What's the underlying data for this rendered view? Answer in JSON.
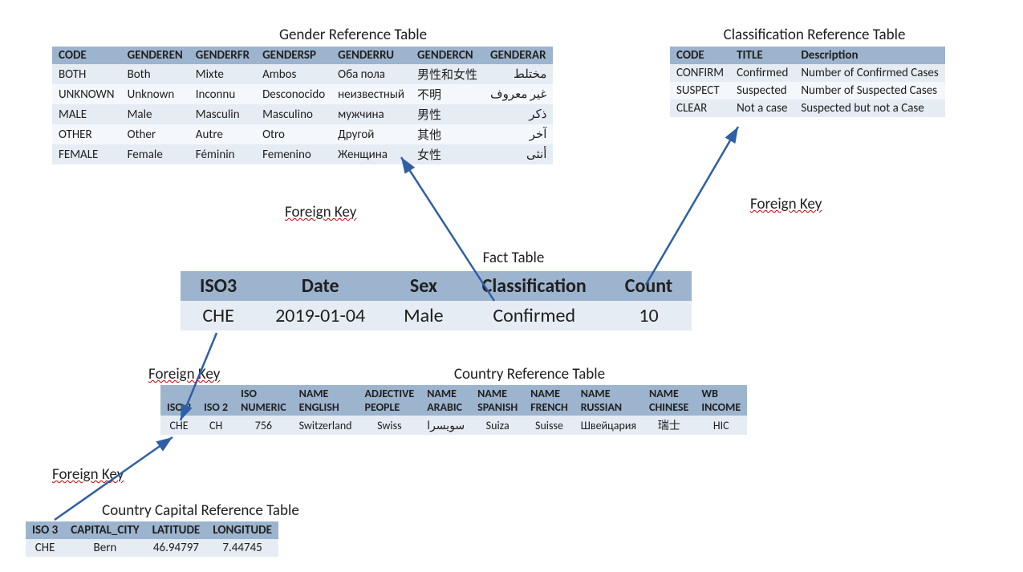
{
  "gender": {
    "title": "Gender Reference Table",
    "headers": [
      "CODE",
      "GENDEREN",
      "GENDERFR",
      "GENDERSP",
      "GENDERRU",
      "GENDERCN",
      "GENDERAR"
    ],
    "rows": [
      [
        "BOTH",
        "Both",
        "Mixte",
        "Ambos",
        "Оба пола",
        "男性和女性",
        "مختلط"
      ],
      [
        "UNKNOWN",
        "Unknown",
        "Inconnu",
        "Desconocido",
        "неизвестный",
        "不明",
        "غير معروف"
      ],
      [
        "MALE",
        "Male",
        "Masculin",
        "Masculino",
        "мужчина",
        "男性",
        "ذكر"
      ],
      [
        "OTHER",
        "Other",
        "Autre",
        "Otro",
        "Другой",
        "其他",
        "آخر"
      ],
      [
        "FEMALE",
        "Female",
        "Féminin",
        "Femenino",
        "Женщина",
        "女性",
        "أنثى"
      ]
    ]
  },
  "classification": {
    "title": "Classification Reference Table",
    "headers": [
      "CODE",
      "TITLE",
      "Description"
    ],
    "rows": [
      [
        "CONFIRM",
        "Confirmed",
        "Number of Confirmed Cases"
      ],
      [
        "SUSPECT",
        "Suspected",
        "Number of Suspected Cases"
      ],
      [
        "CLEAR",
        "Not a case",
        "Suspected but not a Case"
      ]
    ]
  },
  "fact": {
    "title": "Fact Table",
    "headers": [
      "ISO3",
      "Date",
      "Sex",
      "Classification",
      "Count"
    ],
    "row": [
      "CHE",
      "2019-01-04",
      "Male",
      "Confirmed",
      "10"
    ]
  },
  "country": {
    "title": "Country Reference Table",
    "headers": [
      "ISO 3",
      "ISO 2",
      "ISO NUMERIC",
      "NAME ENGLISH",
      "ADJECTIVE PEOPLE",
      "NAME ARABIC",
      "NAME SPANISH",
      "NAME FRENCH",
      "NAME RUSSIAN",
      "NAME CHINESE",
      "WB INCOME"
    ],
    "rows": [
      [
        "CHE",
        "CH",
        "756",
        "Switzerland",
        "Swiss",
        "سويسرا",
        "Suiza",
        "Suisse",
        "Швейцария",
        "瑞士",
        "HIC"
      ]
    ]
  },
  "capital": {
    "title": "Country Capital Reference Table",
    "headers": [
      "ISO 3",
      "CAPITAL_CITY",
      "LATITUDE",
      "LONGITUDE"
    ],
    "rows": [
      [
        "CHE",
        "Bern",
        "46.94797",
        "7.44745"
      ]
    ]
  },
  "fk": "Foreign Key"
}
